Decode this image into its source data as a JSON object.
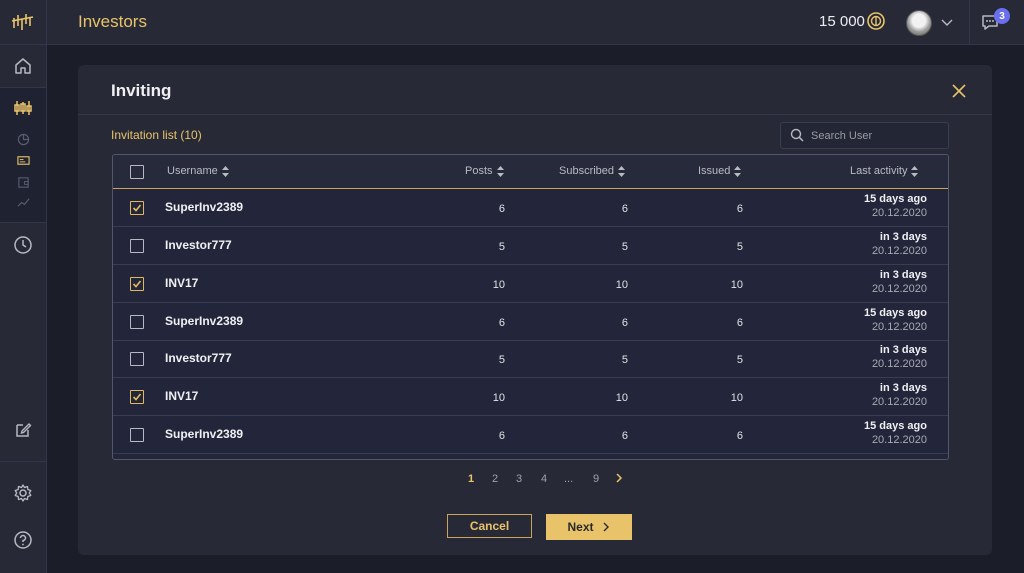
{
  "app": {
    "page_title": "Investors",
    "balance": "15 000",
    "notifications_count": "3",
    "colors": {
      "accent": "#e8c36a",
      "background": "#1b1d28",
      "panel": "#272a36",
      "badge": "#6a6ff0"
    }
  },
  "sidebar": {
    "icons": [
      "logo-icon",
      "home-icon",
      "candles-icon",
      "pie-chart-icon",
      "id-card-icon",
      "wallet-icon",
      "trend-icon",
      "clock-icon",
      "edit-icon",
      "gear-icon",
      "help-icon"
    ]
  },
  "modal": {
    "title": "Inviting",
    "invitation_list_label": "Invitation list (10)",
    "search_placeholder": "Search User",
    "columns": {
      "username": "Username",
      "posts": "Posts",
      "subscribed": "Subscribed",
      "issued": "Issued",
      "last_activity": "Last activity"
    },
    "rows": [
      {
        "checked": true,
        "username": "SuperInv2389",
        "posts": "6",
        "subscribed": "6",
        "issued": "6",
        "activity": "15 days ago",
        "date": "20.12.2020"
      },
      {
        "checked": false,
        "username": "Investor777",
        "posts": "5",
        "subscribed": "5",
        "issued": "5",
        "activity": "in 3 days",
        "date": "20.12.2020"
      },
      {
        "checked": true,
        "username": "INV17",
        "posts": "10",
        "subscribed": "10",
        "issued": "10",
        "activity": "in 3 days",
        "date": "20.12.2020"
      },
      {
        "checked": false,
        "username": "SuperInv2389",
        "posts": "6",
        "subscribed": "6",
        "issued": "6",
        "activity": "15 days ago",
        "date": "20.12.2020"
      },
      {
        "checked": false,
        "username": "Investor777",
        "posts": "5",
        "subscribed": "5",
        "issued": "5",
        "activity": "in 3 days",
        "date": "20.12.2020"
      },
      {
        "checked": true,
        "username": "INV17",
        "posts": "10",
        "subscribed": "10",
        "issued": "10",
        "activity": "in 3 days",
        "date": "20.12.2020"
      },
      {
        "checked": false,
        "username": "SuperInv2389",
        "posts": "6",
        "subscribed": "6",
        "issued": "6",
        "activity": "15 days ago",
        "date": "20.12.2020"
      }
    ],
    "pagination": {
      "pages": [
        "1",
        "2",
        "3",
        "4",
        "...",
        "9"
      ],
      "current": "1"
    },
    "cancel_label": "Cancel",
    "next_label": "Next"
  }
}
